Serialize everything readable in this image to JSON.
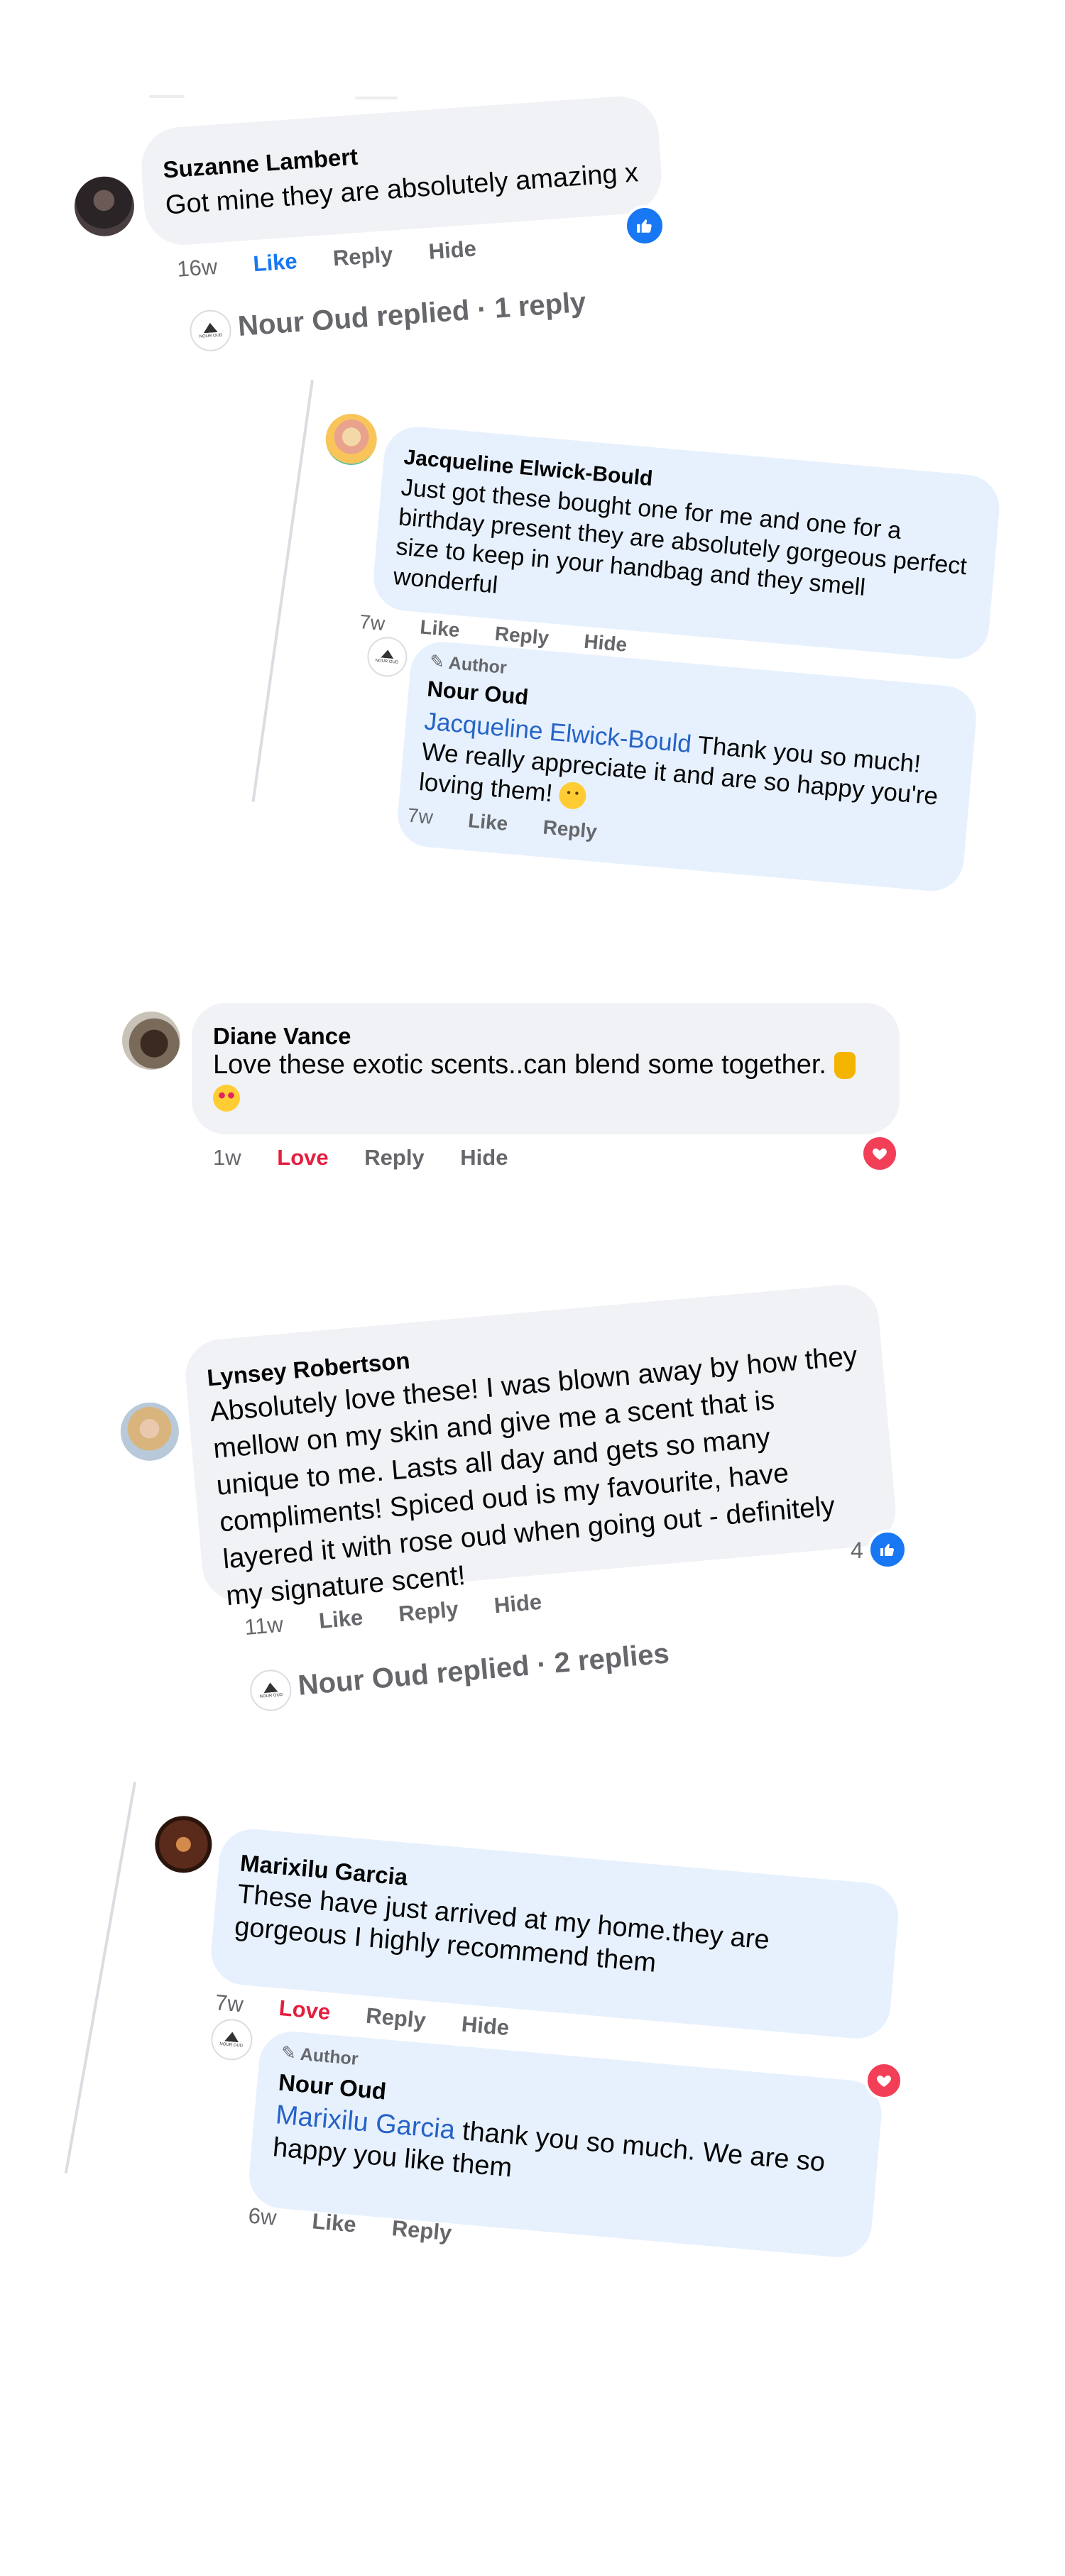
{
  "comments": [
    {
      "author": "Suzanne Lambert",
      "text": "Got mine they are absolutely amazing x",
      "time": "16w",
      "like": "Like",
      "reply": "Reply",
      "hide": "Hide",
      "replied_label": "Nour Oud replied · 1 reply",
      "reaction_icon": "like-icon"
    },
    {
      "author": "Jacqueline Elwick-Bould",
      "text": "Just got these bought one for me and one for a birthday present they are absolutely gorgeous perfect size to keep in your handbag and they smell wonderful",
      "time": "7w",
      "like": "Like",
      "reply": "Reply",
      "hide": "Hide"
    },
    {
      "author_badge": "Author",
      "author": "Nour Oud",
      "mention": "Jacqueline Elwick-Bould",
      "text": "Thank you so much! We really appreciate it and are so happy you're loving them!",
      "time": "7w",
      "like": "Like",
      "reply": "Reply"
    },
    {
      "author": "Diane Vance",
      "text": "Love these exotic scents..can blend some together.",
      "time": "1w",
      "love": "Love",
      "reply": "Reply",
      "hide": "Hide",
      "reaction_icon": "heart-icon"
    },
    {
      "author": "Lynsey Robertson",
      "text": "Absolutely love these! I was blown away by how they mellow on my skin and give me a scent that is unique to me. Lasts all day and gets so many compliments! Spiced oud is my favourite, have layered it with rose oud when going out - definitely my signature scent!",
      "reaction_count": "4",
      "time": "11w",
      "like": "Like",
      "reply": "Reply",
      "hide": "Hide",
      "replied_label": "Nour Oud replied · 2 replies",
      "reaction_icon": "like-icon"
    },
    {
      "author": "Marixilu Garcia",
      "text": "These have just arrived at my home.they are gorgeous I highly recommend them",
      "time": "7w",
      "love": "Love",
      "reply": "Reply",
      "hide": "Hide"
    },
    {
      "author_badge": "Author",
      "author": "Nour Oud",
      "mention": "Marixilu Garcia",
      "text": "thank you so much. We are so happy you like them",
      "time": "6w",
      "like": "Like",
      "reply": "Reply",
      "reaction_icon": "heart-icon"
    }
  ],
  "logo_text": "NOUR OUD",
  "colors": {
    "bubble_grey": "#f0f2f5",
    "bubble_blue": "#e7f1fd",
    "like_blue": "#1877f2",
    "love_red": "#e41e3f",
    "mention_blue": "#2563c7",
    "meta_grey": "#65676b"
  }
}
